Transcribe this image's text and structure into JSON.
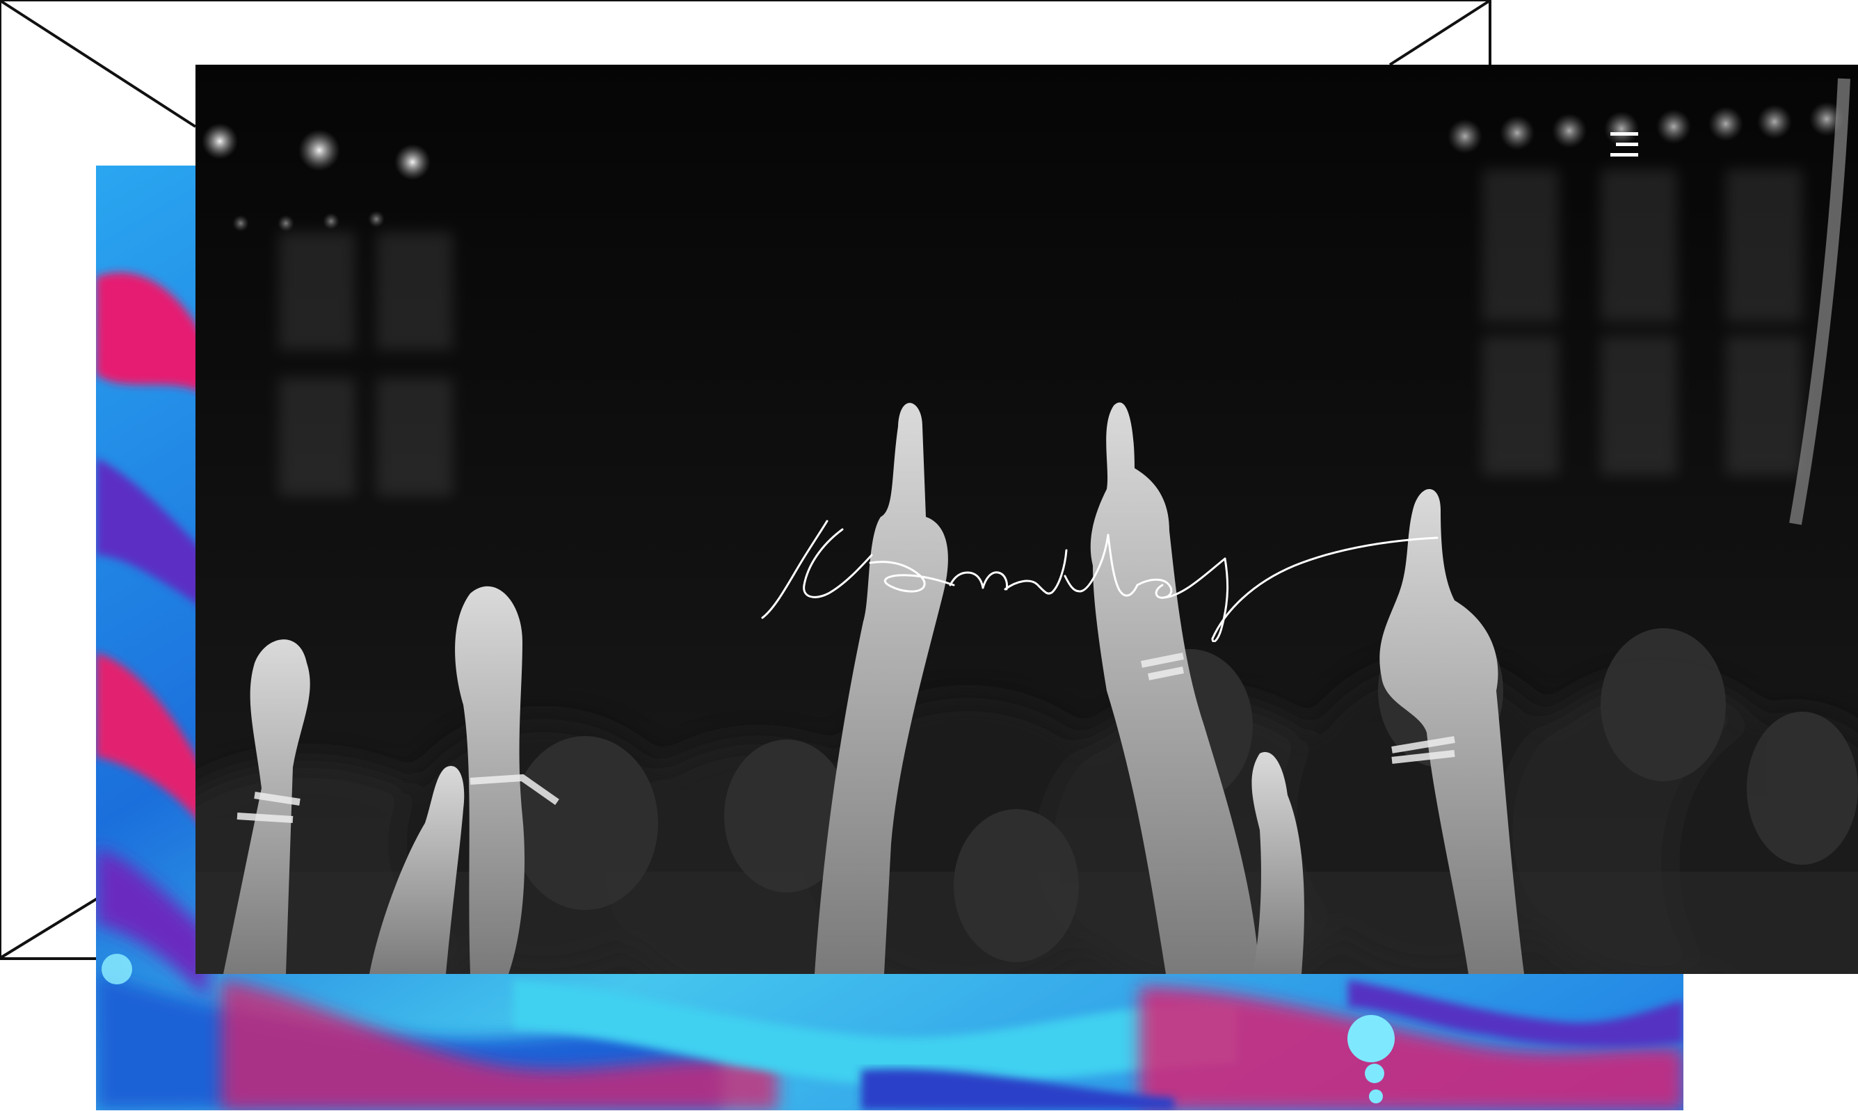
{
  "hero": {
    "brand_name": "Kemilly",
    "menu_icon": "hamburger-menu-icon",
    "image_subject": "crowd-raising-hands-concert-photo"
  },
  "colors": {
    "frame_stroke": "#111111",
    "paint_blue": "#1f8fe8",
    "paint_cyan": "#35c8ef",
    "paint_magenta": "#e41f74",
    "paint_violet": "#5a34c6",
    "hero_dark": "#0b0b0b",
    "logo_stroke": "#ffffff"
  }
}
